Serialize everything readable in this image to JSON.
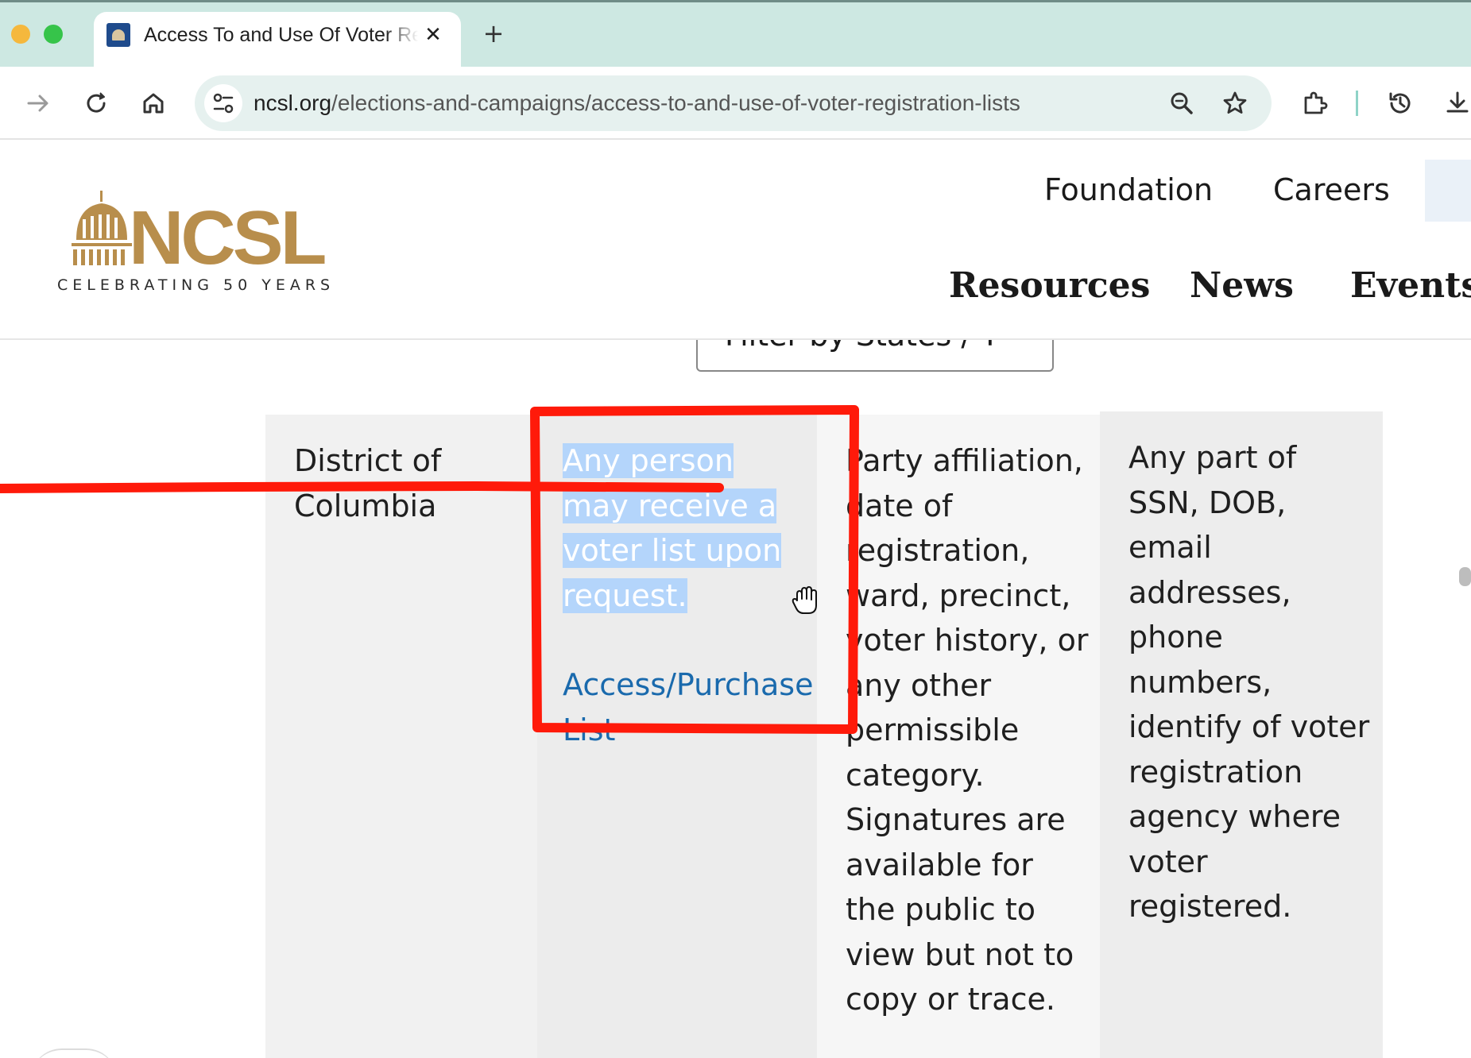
{
  "browser": {
    "tab": {
      "title": "Access To and Use Of Voter Registration Lists",
      "close_glyph": "✕"
    },
    "new_tab_glyph": "+",
    "address": {
      "host": "ncsl.org",
      "path": "/elections-and-campaigns/access-to-and-use-of-voter-registration-lists"
    }
  },
  "header": {
    "logo": {
      "wordmark": "NCSL",
      "tagline": "CELEBRATING 50 YEARS",
      "color": "#b88e4c"
    },
    "utility_links": [
      "Foundation",
      "Careers"
    ],
    "main_nav": [
      "Resources",
      "News",
      "Events"
    ]
  },
  "filter": {
    "label": "Filter by States / T"
  },
  "table_row": {
    "state": "District of Columbia",
    "access_text": "Any person may receive a voter list upon request.",
    "access_link": "Access/Purchase List",
    "info_available": "Party affiliation, date of registration, ward, precinct, voter history, or any other permissible category. Signatures are available for the public to view but not to copy or trace.",
    "restricted_info": "Any part of SSN, DOB, email addresses, phone numbers, identify of voter registration agency where voter registered."
  },
  "colors": {
    "annotation": "#ff1a0a",
    "link": "#1a6aad",
    "selection": "#b4d5fb"
  }
}
